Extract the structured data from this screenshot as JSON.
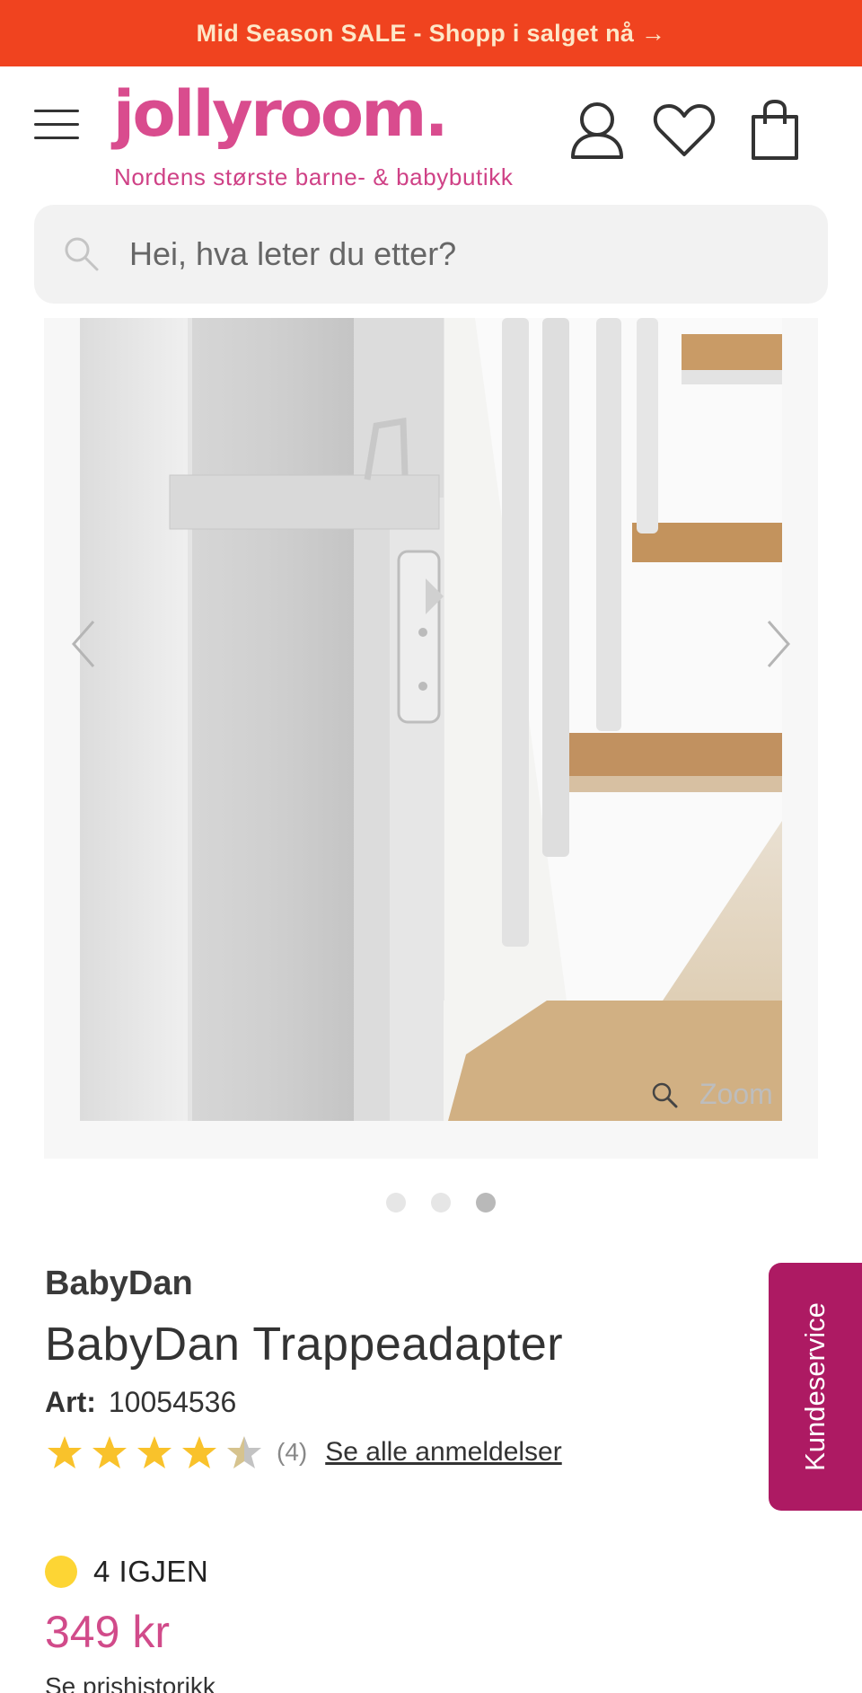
{
  "promo_banner": {
    "text": "Mid Season SALE - Shopp i salget nå →"
  },
  "header": {
    "logo": "jollyroom.",
    "tagline": "Nordens største barne- & babybutikk",
    "icons": [
      "menu-icon",
      "account-icon",
      "wishlist-heart-icon",
      "cart-bag-icon"
    ]
  },
  "search": {
    "placeholder": "Hei, hva leter du etter?"
  },
  "gallery": {
    "zoom_label": "Zoom",
    "image_count": 3,
    "active_index": 2
  },
  "product": {
    "brand": "BabyDan",
    "title": "BabyDan Trappeadapter",
    "art_label": "Art:",
    "art_number": "10054536",
    "rating": 4,
    "rating_max": 5,
    "review_count": "(4)",
    "reviews_link": "Se alle anmeldelser",
    "stock_text": "4 IGJEN",
    "price": "349 kr",
    "price_history_link": "Se prishistorikk"
  },
  "customer_service": {
    "label": "Kundeservice"
  },
  "colors": {
    "promo_bg": "#f0431f",
    "brand_pink": "#d94c8e",
    "price_pink": "#d14b8a",
    "service_magenta": "#ad1a63",
    "star_yellow": "#f9c22b",
    "stock_yellow": "#fdd534"
  }
}
